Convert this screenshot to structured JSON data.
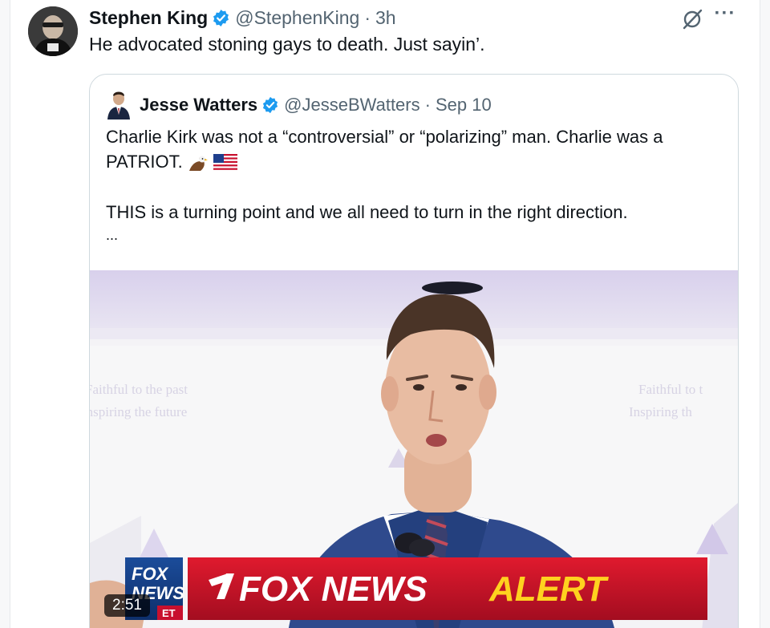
{
  "tweet": {
    "author_name": "Stephen King",
    "handle": "@StephenKing",
    "separator": "·",
    "time": "3h",
    "text": "He advocated stoning gays to death. Just sayin’."
  },
  "quoted": {
    "author_name": "Jesse Watters",
    "handle": "@JesseBWatters",
    "separator": "·",
    "date": "Sep 10",
    "line1": "Charlie Kirk was not a “controversial” or “polarizing” man. Charlie was a",
    "line2": "PATRIOT.",
    "line3": "THIS is a turning point and we all need to turn in the right direction.",
    "ellipsis": "...",
    "media": {
      "banner_brand": "FOX NEWS",
      "banner_alert": "ALERT",
      "logo_text_top": "FOX",
      "logo_text_bottom": "NEWS",
      "logo_et": "ET",
      "duration": "2:51",
      "backdrop_left_line1": "Faithful to the past",
      "backdrop_left_line2": "Inspiring the future",
      "backdrop_right_line1": "Faithful to t",
      "backdrop_right_line2": "Inspiring th"
    }
  },
  "colors": {
    "verified": "#1d9bf0",
    "handle_gray": "#536471",
    "banner_red": "#c8102e",
    "alert_yellow": "#ffd21f"
  },
  "icons": [
    "verified-badge-icon",
    "grok-icon",
    "more-options-icon",
    "eagle-emoji-icon",
    "us-flag-emoji-icon"
  ]
}
